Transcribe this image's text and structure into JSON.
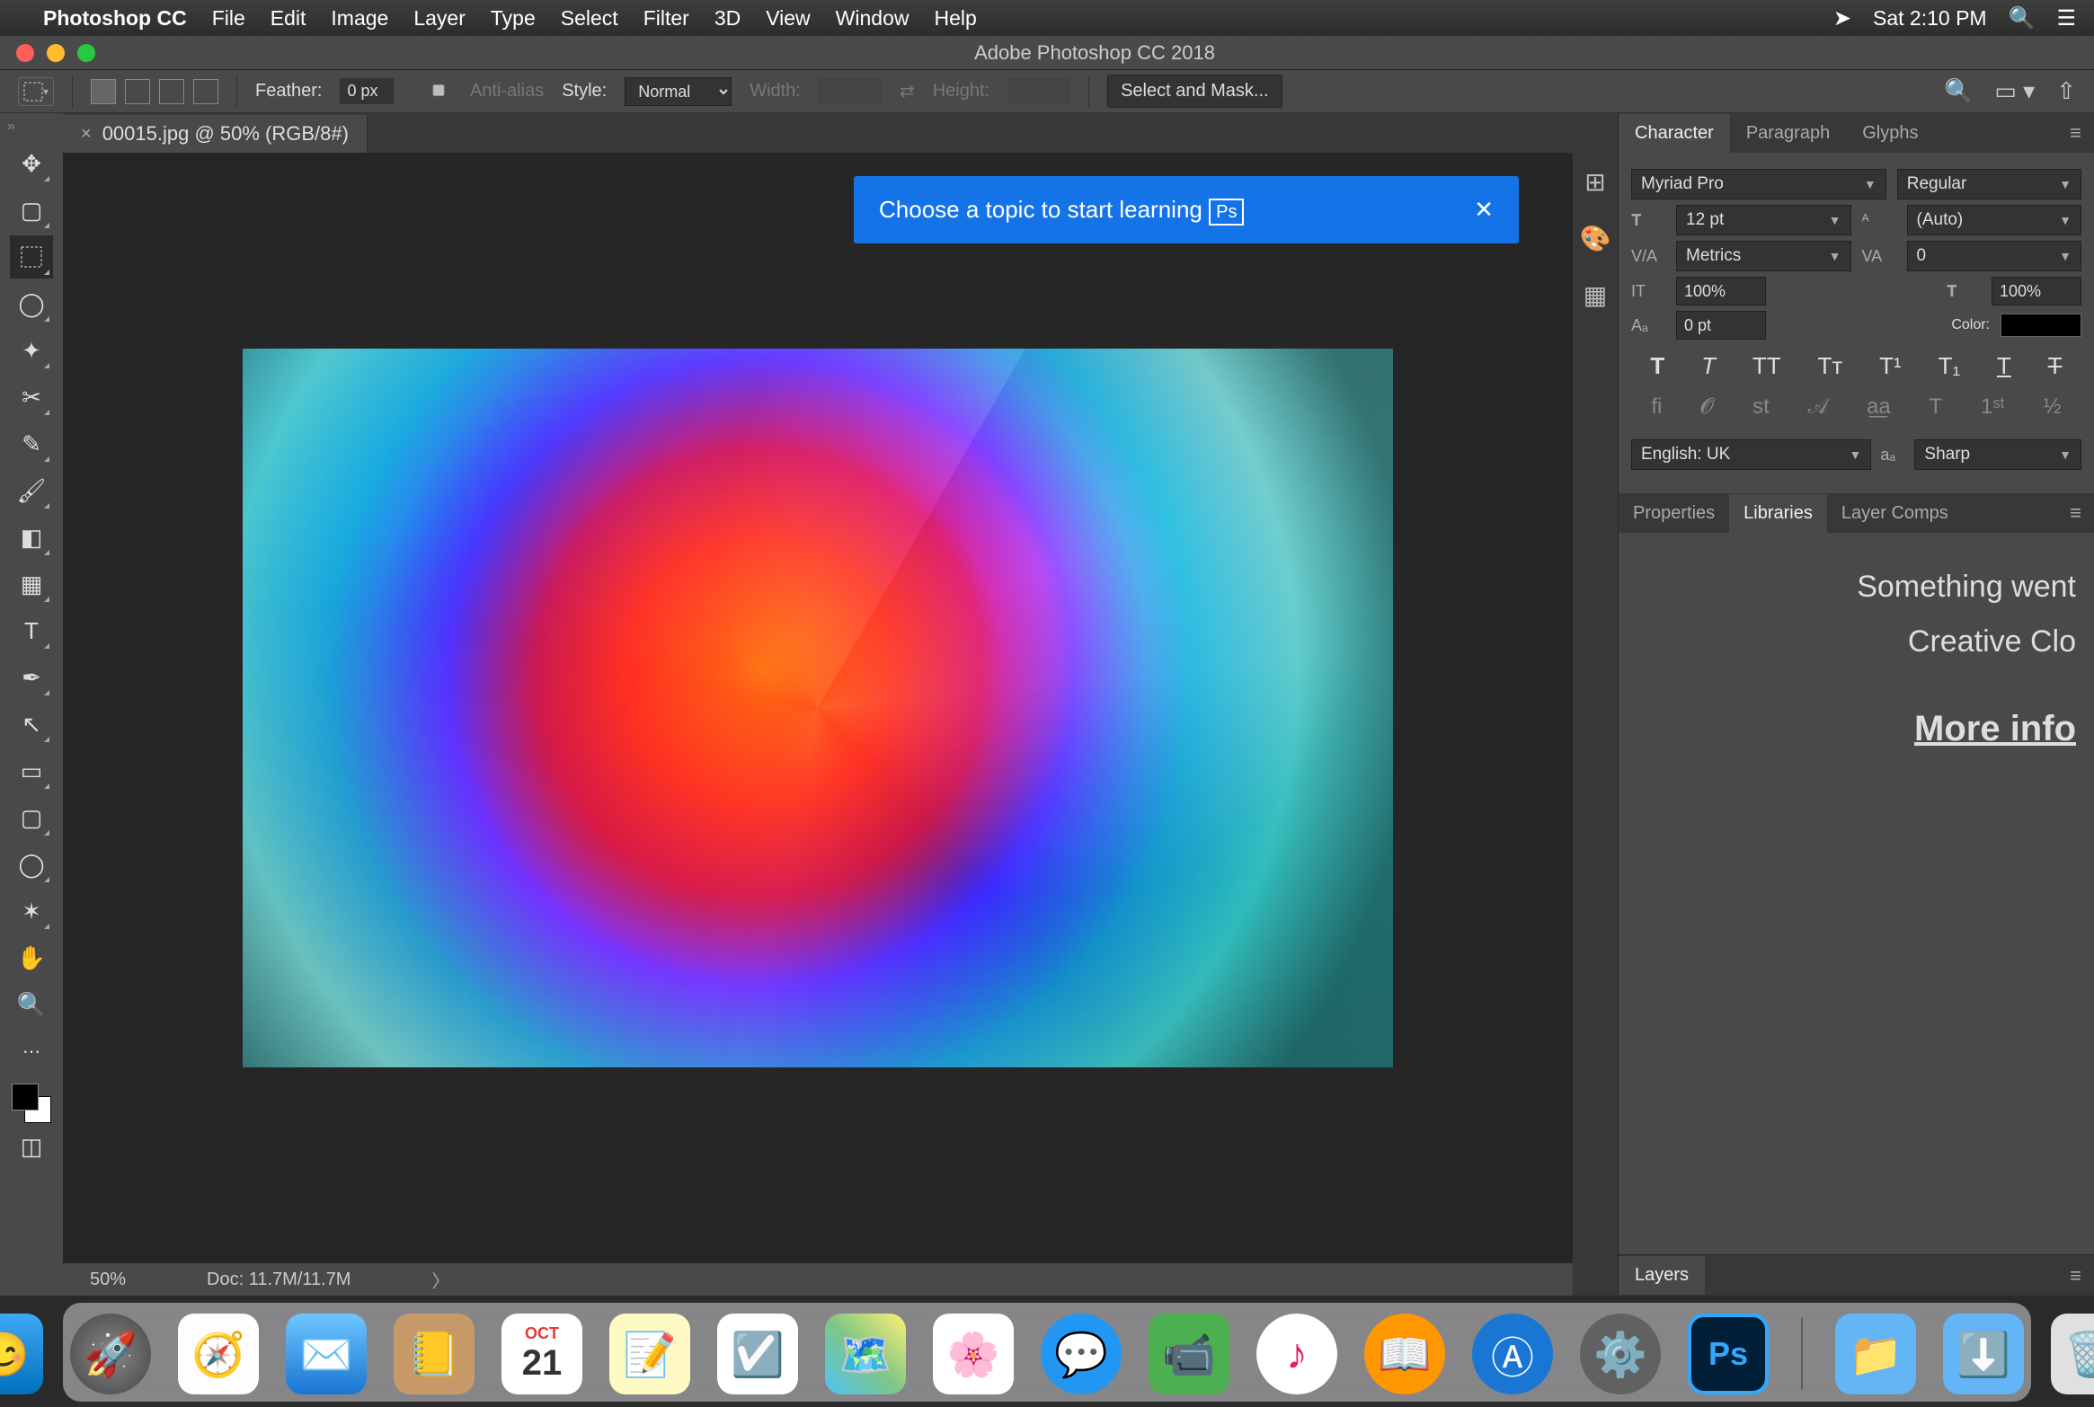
{
  "menubar": {
    "app_name": "Photoshop CC",
    "menus": [
      "File",
      "Edit",
      "Image",
      "Layer",
      "Type",
      "Select",
      "Filter",
      "3D",
      "View",
      "Window",
      "Help"
    ],
    "clock": "Sat 2:10 PM"
  },
  "window": {
    "title": "Adobe Photoshop CC 2018"
  },
  "options": {
    "feather_label": "Feather:",
    "feather_value": "0 px",
    "antialias_label": "Anti-alias",
    "style_label": "Style:",
    "style_value": "Normal",
    "width_label": "Width:",
    "height_label": "Height:",
    "select_mask": "Select and Mask..."
  },
  "document": {
    "tab_title": "00015.jpg @ 50% (RGB/8#)"
  },
  "tooltip": {
    "text": "Choose a topic to start learning",
    "badge": "Ps"
  },
  "status": {
    "zoom": "50%",
    "doc_size": "Doc: 11.7M/11.7M"
  },
  "char_panel": {
    "tabs": [
      "Character",
      "Paragraph",
      "Glyphs"
    ],
    "font_family": "Myriad Pro",
    "font_style": "Regular",
    "font_size": "12 pt",
    "leading": "(Auto)",
    "kerning": "Metrics",
    "tracking": "0",
    "v_scale": "100%",
    "h_scale": "100%",
    "baseline": "0 pt",
    "color_label": "Color:",
    "language": "English: UK",
    "antialias": "Sharp"
  },
  "panel2": {
    "tabs": [
      "Properties",
      "Libraries",
      "Layer Comps"
    ],
    "error_line1": "Something went",
    "error_line2": "Creative Clo",
    "more_info": "More info"
  },
  "layers_panel": {
    "title": "Layers"
  },
  "dock": {
    "calendar_month": "OCT",
    "calendar_day": "21"
  }
}
